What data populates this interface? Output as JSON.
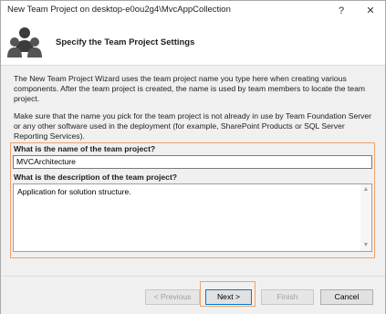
{
  "window": {
    "title": "New Team Project on desktop-e0ou2g4\\MvcAppCollection",
    "help_label": "?",
    "close_label": "✕"
  },
  "header": {
    "title": "Specify the Team Project Settings",
    "icon": "team-people-icon"
  },
  "content": {
    "para1": "The New Team Project Wizard uses the team project name you type here when creating various components. After the team project is created, the name is used by team members to locate the team project.",
    "para2": "Make sure that the name you pick for the team project is not already in use by Team Foundation Server or any other software used in the deployment (for example, SharePoint Products or SQL Server Reporting Services).",
    "name_label": "What is the name of the team project?",
    "name_value": "MVCArchitecture",
    "desc_label": "What is the description of the team project?",
    "desc_value": "Application for solution structure."
  },
  "footer": {
    "previous_label": "< Previous",
    "next_label": "Next >",
    "finish_label": "Finish",
    "cancel_label": "Cancel"
  },
  "colors": {
    "focus_highlight": "#f0a36a",
    "accent": "#0078d7"
  }
}
